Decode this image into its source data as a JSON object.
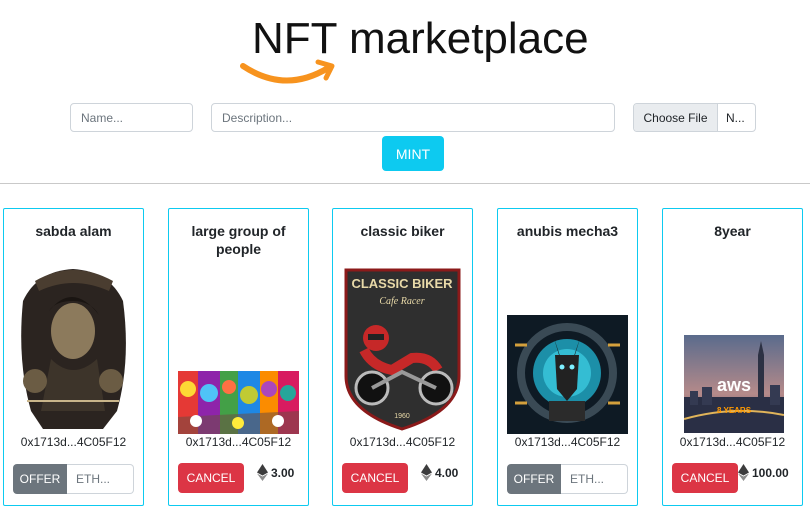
{
  "header": {
    "logo_text": "NFT marketplace"
  },
  "mint_form": {
    "name_placeholder": "Name...",
    "description_placeholder": "Description...",
    "choose_file_label": "Choose File",
    "file_status": "N...",
    "mint_label": "MINT"
  },
  "colors": {
    "accent": "#0dcaf0",
    "danger": "#dc3545",
    "secondary": "#6c757d",
    "logo_smile": "#f7931e"
  },
  "cards": [
    {
      "title": "sabda alam",
      "owner": "0x1713d...4C05F12",
      "action": "offer",
      "offer_label": "OFFER",
      "eth_placeholder": "ETH..."
    },
    {
      "title": "large group of people",
      "owner": "0x1713d...4C05F12",
      "action": "cancel",
      "cancel_label": "CANCEL",
      "price": "3.00"
    },
    {
      "title": "classic biker",
      "owner": "0x1713d...4C05F12",
      "action": "cancel",
      "cancel_label": "CANCEL",
      "price": "4.00",
      "image_text": [
        "CLASSIC BIKER",
        "Cafe Racer",
        "1960"
      ]
    },
    {
      "title": "anubis mecha3",
      "owner": "0x1713d...4C05F12",
      "action": "offer",
      "offer_label": "OFFER",
      "eth_placeholder": "ETH..."
    },
    {
      "title": "8year",
      "owner": "0x1713d...4C05F12",
      "action": "cancel",
      "cancel_label": "CANCEL",
      "price": "100.00",
      "image_text": [
        "aws",
        "8 YEARS"
      ]
    }
  ]
}
